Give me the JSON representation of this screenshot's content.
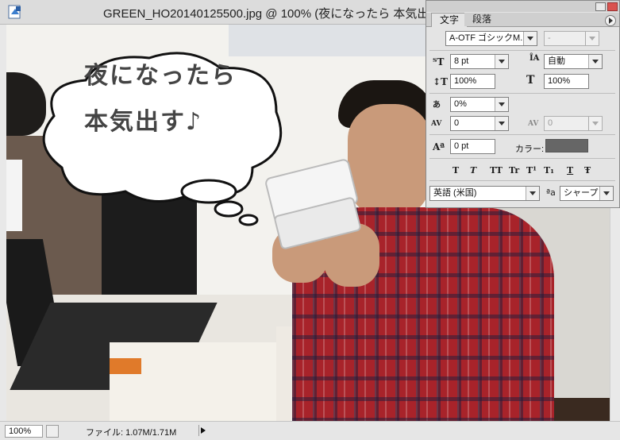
{
  "window": {
    "title": "GREEN_HO20140125500.jpg @ 100% (夜になったら 本気出",
    "app_icon": "photoshop-document-icon"
  },
  "image": {
    "bubble_line1": "夜になったら",
    "bubble_line2": "本気出す♪"
  },
  "status": {
    "zoom": "100%",
    "file_info": "ファイル: 1.07M/1.71M"
  },
  "panel": {
    "tabs": [
      "文字",
      "段落"
    ],
    "font_family": "A-OTF ゴシックM...",
    "font_style": "-",
    "font_size": "8 pt",
    "leading": "自動",
    "vertical_scale": "100%",
    "horizontal_scale": "100%",
    "tsume": "0%",
    "kerning": "0",
    "tracking": "0",
    "baseline_shift": "0 pt",
    "color_label": "カラー:",
    "color_value": "#666666",
    "style_buttons": [
      "T",
      "T",
      "TT",
      "Tr",
      "T¹",
      "T₁",
      "T",
      "Ŧ"
    ],
    "language": "英語 (米国)",
    "antialias_label": "ªa",
    "antialias": "シャープ"
  }
}
